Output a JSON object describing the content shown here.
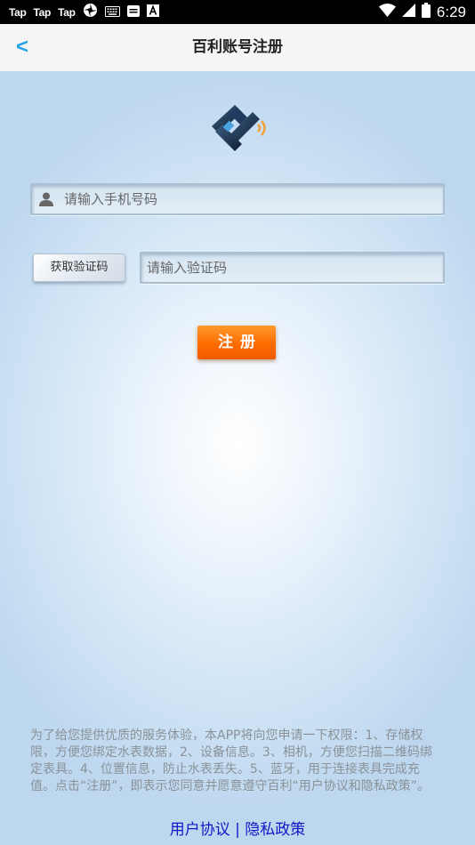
{
  "statusbar": {
    "apps": [
      "Tap",
      "Tap",
      "Tap"
    ],
    "time": "6:29",
    "icons": [
      "camera-shutter-icon",
      "keyboard-icon",
      "message-icon",
      "font-a-icon",
      "wifi-icon",
      "signal-icon",
      "battery-icon"
    ]
  },
  "header": {
    "back_label": "<",
    "title": "百利账号注册"
  },
  "form": {
    "phone_placeholder": "请输入手机号码",
    "phone_value": "",
    "get_code_label": "获取验证码",
    "code_placeholder": "请输入验证码",
    "code_value": "",
    "register_label": "注册"
  },
  "notice": {
    "text": "为了给您提供优质的服务体验，本APP将向您申请一下权限：1、存储权限，方便您绑定水表数据，2、设备信息。3、相机，方便您扫描二维码绑定表具。4、位置信息，防止水表丢失。5、蓝牙，用于连接表具完成充值。点击“注册”，即表示您同意并愿意遵守百利“用户协议和隐私政策”。"
  },
  "footer": {
    "user_agreement": "用户协议",
    "separator": " | ",
    "privacy_policy": "隐私政策"
  },
  "colors": {
    "accent": "#2aa2e8",
    "register": "#ff6c00",
    "link": "#1515c8"
  }
}
